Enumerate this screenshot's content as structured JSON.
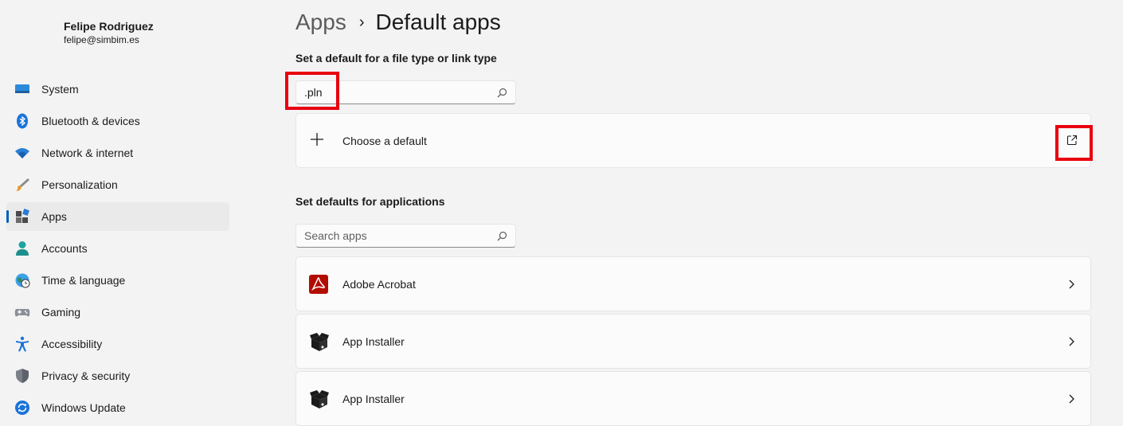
{
  "user": {
    "name": "Felipe Rodriguez",
    "email": "felipe@simbim.es"
  },
  "sidebar": {
    "items": [
      {
        "label": "System",
        "icon": "system-icon",
        "active": false
      },
      {
        "label": "Bluetooth & devices",
        "icon": "bluetooth-icon",
        "active": false
      },
      {
        "label": "Network & internet",
        "icon": "wifi-icon",
        "active": false
      },
      {
        "label": "Personalization",
        "icon": "brush-icon",
        "active": false
      },
      {
        "label": "Apps",
        "icon": "apps-icon",
        "active": true
      },
      {
        "label": "Accounts",
        "icon": "person-icon",
        "active": false
      },
      {
        "label": "Time & language",
        "icon": "globe-clock-icon",
        "active": false
      },
      {
        "label": "Gaming",
        "icon": "gamepad-icon",
        "active": false
      },
      {
        "label": "Accessibility",
        "icon": "accessibility-icon",
        "active": false
      },
      {
        "label": "Privacy & security",
        "icon": "shield-icon",
        "active": false
      },
      {
        "label": "Windows Update",
        "icon": "update-icon",
        "active": false
      }
    ]
  },
  "header": {
    "parent": "Apps",
    "separator": "›",
    "current": "Default apps"
  },
  "filetype": {
    "title": "Set a default for a file type or link type",
    "value": ".pln",
    "choose_label": "Choose a default"
  },
  "applications": {
    "title": "Set defaults for applications",
    "placeholder": "Search apps",
    "items": [
      {
        "label": "Adobe Acrobat",
        "icon": "adobe-acrobat-icon"
      },
      {
        "label": "App Installer",
        "icon": "app-installer-icon"
      },
      {
        "label": "App Installer",
        "icon": "app-installer-icon"
      }
    ]
  },
  "colors": {
    "accent": "#005fb8",
    "highlight": "#e8000f",
    "acrobat": "#b30b00"
  }
}
